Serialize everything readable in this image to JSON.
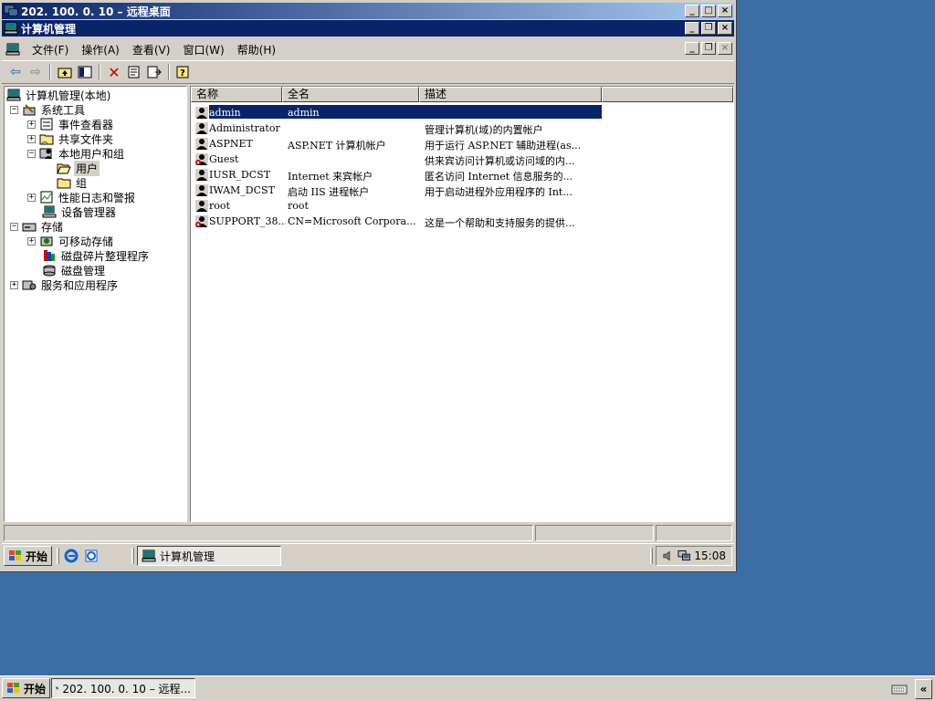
{
  "rdp": {
    "title": "202. 100. 0. 10 – 远程桌面"
  },
  "window": {
    "title": "计算机管理"
  },
  "menu": [
    "文件(F)",
    "操作(A)",
    "查看(V)",
    "窗口(W)",
    "帮助(H)"
  ],
  "tree": {
    "root": "计算机管理(本地)",
    "items": {
      "system_tools": "系统工具",
      "event_viewer": "事件查看器",
      "shared_folders": "共享文件夹",
      "local_users": "本地用户和组",
      "users": "用户",
      "groups": "组",
      "perf_logs": "性能日志和警报",
      "device_manager": "设备管理器",
      "storage": "存储",
      "removable": "可移动存储",
      "defrag": "磁盘碎片整理程序",
      "disk_mgmt": "磁盘管理",
      "services": "服务和应用程序"
    }
  },
  "list": {
    "columns": [
      "名称",
      "全名",
      "描述"
    ],
    "rows": [
      {
        "name": "admin",
        "fullname": "admin",
        "desc": ""
      },
      {
        "name": "Administrator",
        "fullname": "",
        "desc": "管理计算机(域)的内置帐户"
      },
      {
        "name": "ASPNET",
        "fullname": "ASP.NET 计算机帐户",
        "desc": "用于运行 ASP.NET 辅助进程(as..."
      },
      {
        "name": "Guest",
        "fullname": "",
        "desc": "供来宾访问计算机或访问域的内..."
      },
      {
        "name": "IUSR_DCST",
        "fullname": "Internet 来宾帐户",
        "desc": "匿名访问 Internet 信息服务的..."
      },
      {
        "name": "IWAM_DCST",
        "fullname": "启动 IIS 进程帐户",
        "desc": "用于启动进程外应用程序的 Int..."
      },
      {
        "name": "root",
        "fullname": "root",
        "desc": ""
      },
      {
        "name": "SUPPORT_38...",
        "fullname": "CN=Microsoft Corpora...",
        "desc": "这是一个帮助和支持服务的提供..."
      }
    ]
  },
  "taskbar": {
    "start": "开始",
    "task": "计算机管理",
    "clock": "15:08"
  },
  "outer_taskbar": {
    "start": "开始",
    "task": "202. 100. 0. 10 – 远程..."
  },
  "colors": {
    "desktop": "#3a6ea5",
    "titlebar": "#0a246a",
    "face": "#d4d0c8"
  }
}
